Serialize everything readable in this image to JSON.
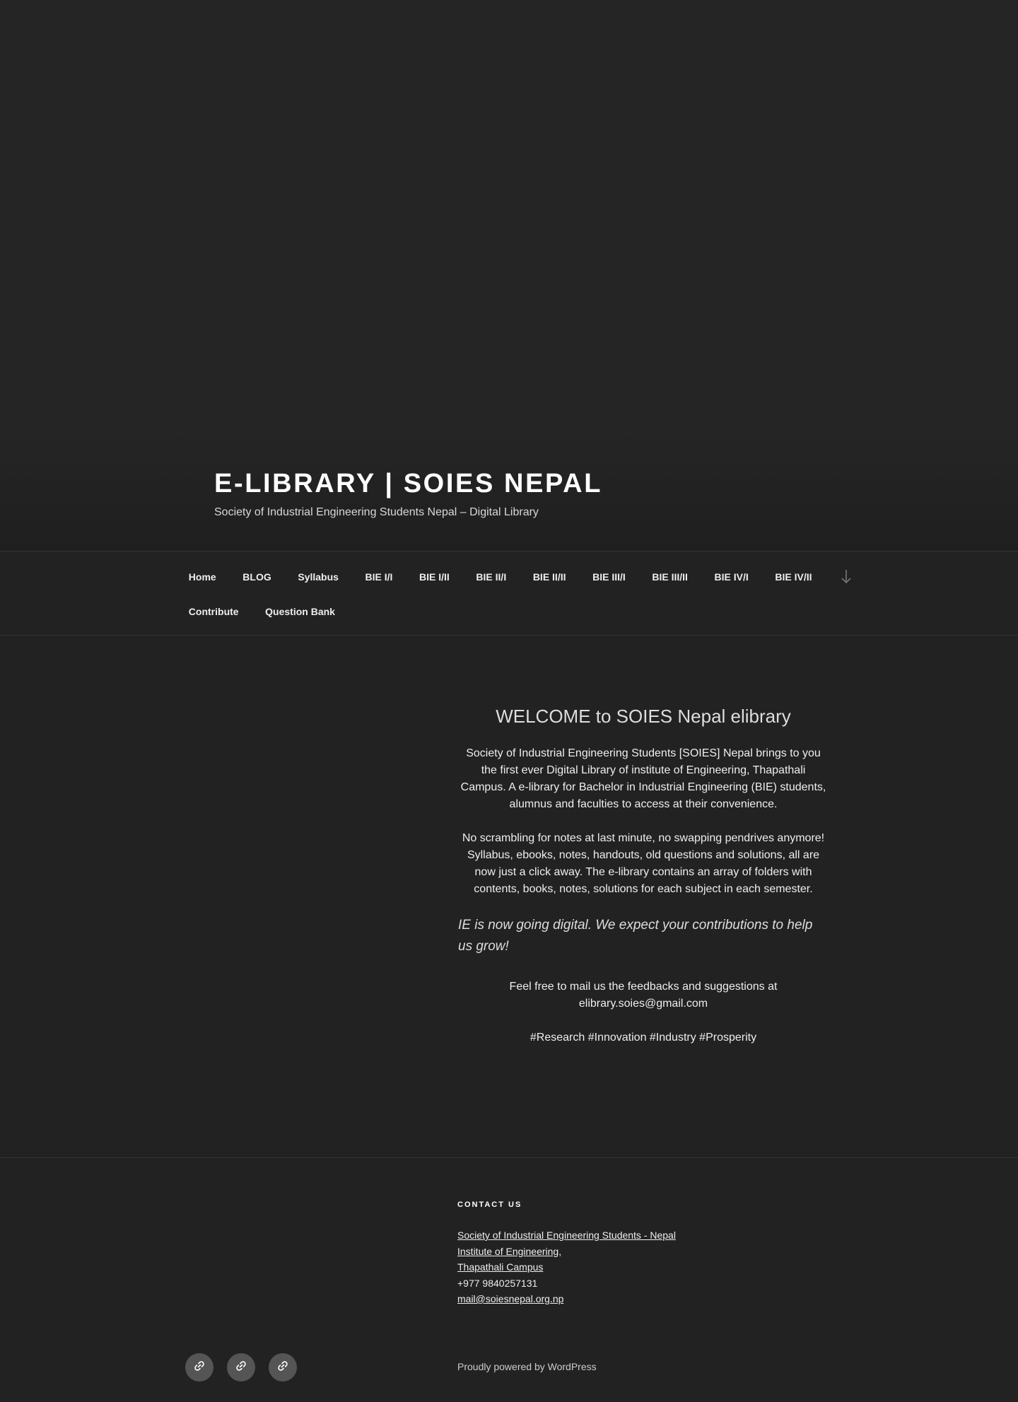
{
  "site": {
    "title": "E-LIBRARY | SOIES NEPAL",
    "description": "Society of Industrial Engineering Students Nepal – Digital Library"
  },
  "nav": {
    "row1": [
      "Home",
      "BLOG",
      "Syllabus",
      "BIE I/I",
      "BIE I/II",
      "BIE II/I",
      "BIE II/II",
      "BIE III/I",
      "BIE III/II",
      "BIE IV/I",
      "BIE IV/II"
    ],
    "row2": [
      "Contribute",
      "Question Bank"
    ],
    "scroll_icon": "arrow-down-icon"
  },
  "content": {
    "heading": "WELCOME to SOIES Nepal elibrary",
    "para1": "Society of Industrial Engineering Students [SOIES] Nepal brings to you the first ever Digital Library of institute of Engineering, Thapathali Campus. A e-library for Bachelor in Industrial Engineering (BIE) students, alumnus and faculties to access at their convenience.",
    "para2": "No scrambling for notes at last minute, no swapping pendrives anymore! Syllabus, ebooks, notes, handouts, old questions and solutions, all are now just a click away. The e-library contains an array of folders with contents, books, notes, solutions for each subject in each semester.",
    "quote": "IE is now going digital. We expect your contributions to help us grow!",
    "feedback": "Feel free to mail us the feedbacks and suggestions at",
    "email": "elibrary.soies@gmail.com",
    "tags": "#Research #Innovation #Industry #Prosperity"
  },
  "footer": {
    "widget_title": "CONTACT US",
    "address_line1": "Society of Industrial Engineering Students - Nepal",
    "address_line2": "Institute of Engineering,",
    "address_line3": "Thapathali Campus",
    "phone": "+977 9840257131",
    "mail": "mail@soiesnepal.org.np",
    "powered": "Proudly powered by WordPress",
    "social_icons": [
      "link-icon",
      "link-icon",
      "link-icon"
    ]
  },
  "colors": {
    "background": "#222222",
    "text": "#eeeeee",
    "social_bg": "#555555"
  }
}
